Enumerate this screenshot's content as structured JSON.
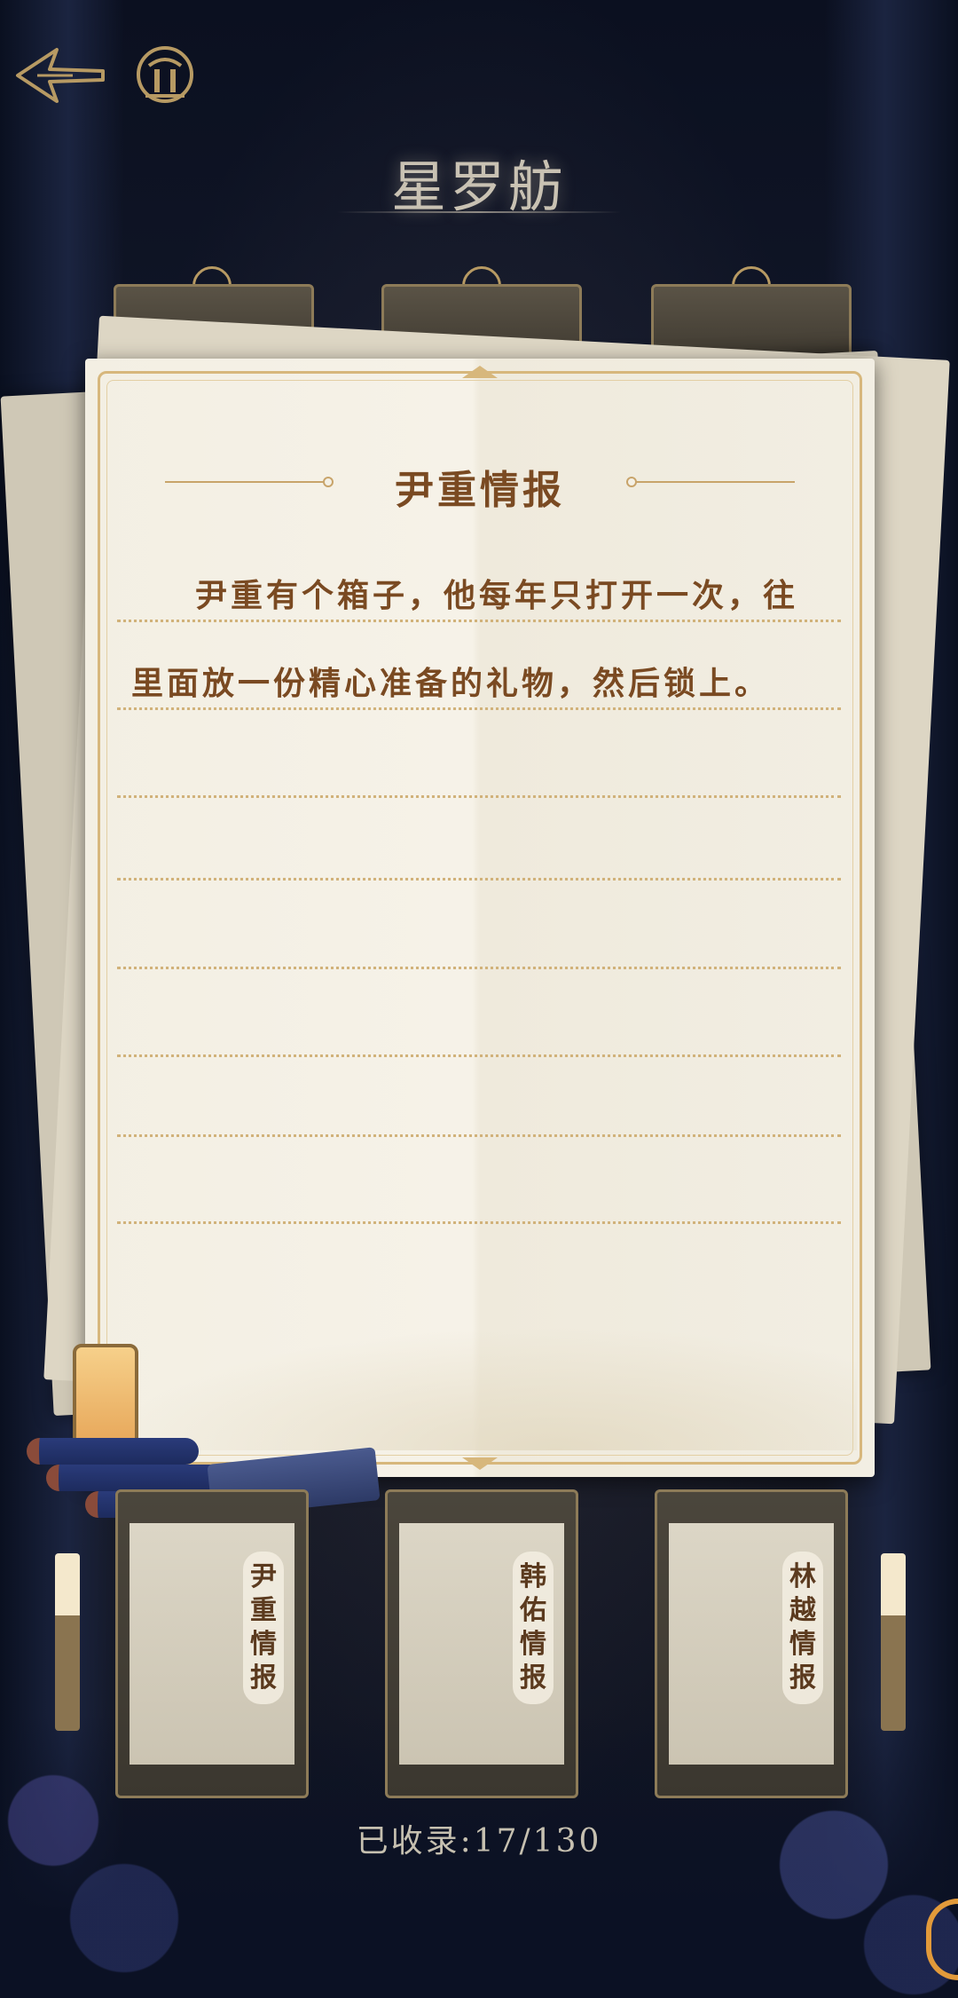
{
  "header": {
    "title": "星罗舫",
    "back_icon": "back-arrow-icon",
    "home_icon": "home-emblem-icon"
  },
  "note": {
    "title": "尹重情报",
    "body": "尹重有个箱子，他每年只打开一次，往里面放一份精心准备的礼物，然后锁上。"
  },
  "categories": [
    {
      "label": "尹重情报"
    },
    {
      "label": "韩佑情报"
    },
    {
      "label": "林越情报"
    }
  ],
  "footer": {
    "collected": "已收录:17/130"
  },
  "colors": {
    "accent_brown": "#7a4a22",
    "gold": "#d7b77c",
    "background": "#0c1222"
  }
}
